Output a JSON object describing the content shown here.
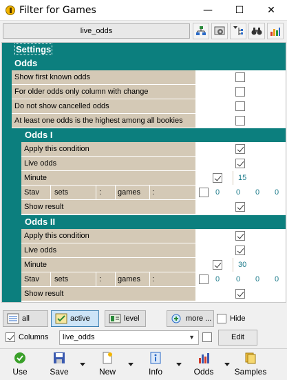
{
  "window": {
    "title": "Filter for Games"
  },
  "toolbar": {
    "preset_name": "live_odds"
  },
  "grid": {
    "settings_label": "Settings",
    "odds_label": "Odds",
    "odds_rows": [
      {
        "label": "Show first known odds",
        "checked": false
      },
      {
        "label": "For older odds only column with change",
        "checked": false
      },
      {
        "label": "Do not show cancelled odds",
        "checked": false
      },
      {
        "label": "At least one odds is the highest among all bookies",
        "checked": false
      }
    ],
    "odds1": {
      "title": "Odds I",
      "apply_label": "Apply this condition",
      "live_label": "Live odds",
      "minute_label": "Minute",
      "minute_value": "15",
      "stav_label": "Stav",
      "sets_label": "sets",
      "games_label": "games",
      "colon": ":",
      "stav_values": [
        "0",
        "0",
        "0",
        "0"
      ],
      "show_result_label": "Show result"
    },
    "odds2": {
      "title": "Odds II",
      "apply_label": "Apply this condition",
      "live_label": "Live odds",
      "minute_label": "Minute",
      "minute_value": "30",
      "stav_label": "Stav",
      "sets_label": "sets",
      "games_label": "games",
      "colon": ":",
      "stav_values": [
        "0",
        "0",
        "0",
        "0"
      ],
      "show_result_label": "Show result"
    }
  },
  "filters": {
    "all_label": "all",
    "active_label": "active",
    "level_label": "level",
    "more_label": "more ...",
    "hide_label": "Hide"
  },
  "columns": {
    "label": "Columns",
    "value": "live_odds",
    "edit_label": "Edit"
  },
  "bottom": {
    "use": "Use",
    "save": "Save",
    "new": "New",
    "info": "Info",
    "odds": "Odds",
    "samples": "Samples"
  },
  "colors": {
    "teal": "#0c7f7e",
    "tan": "#d4c9b6"
  }
}
